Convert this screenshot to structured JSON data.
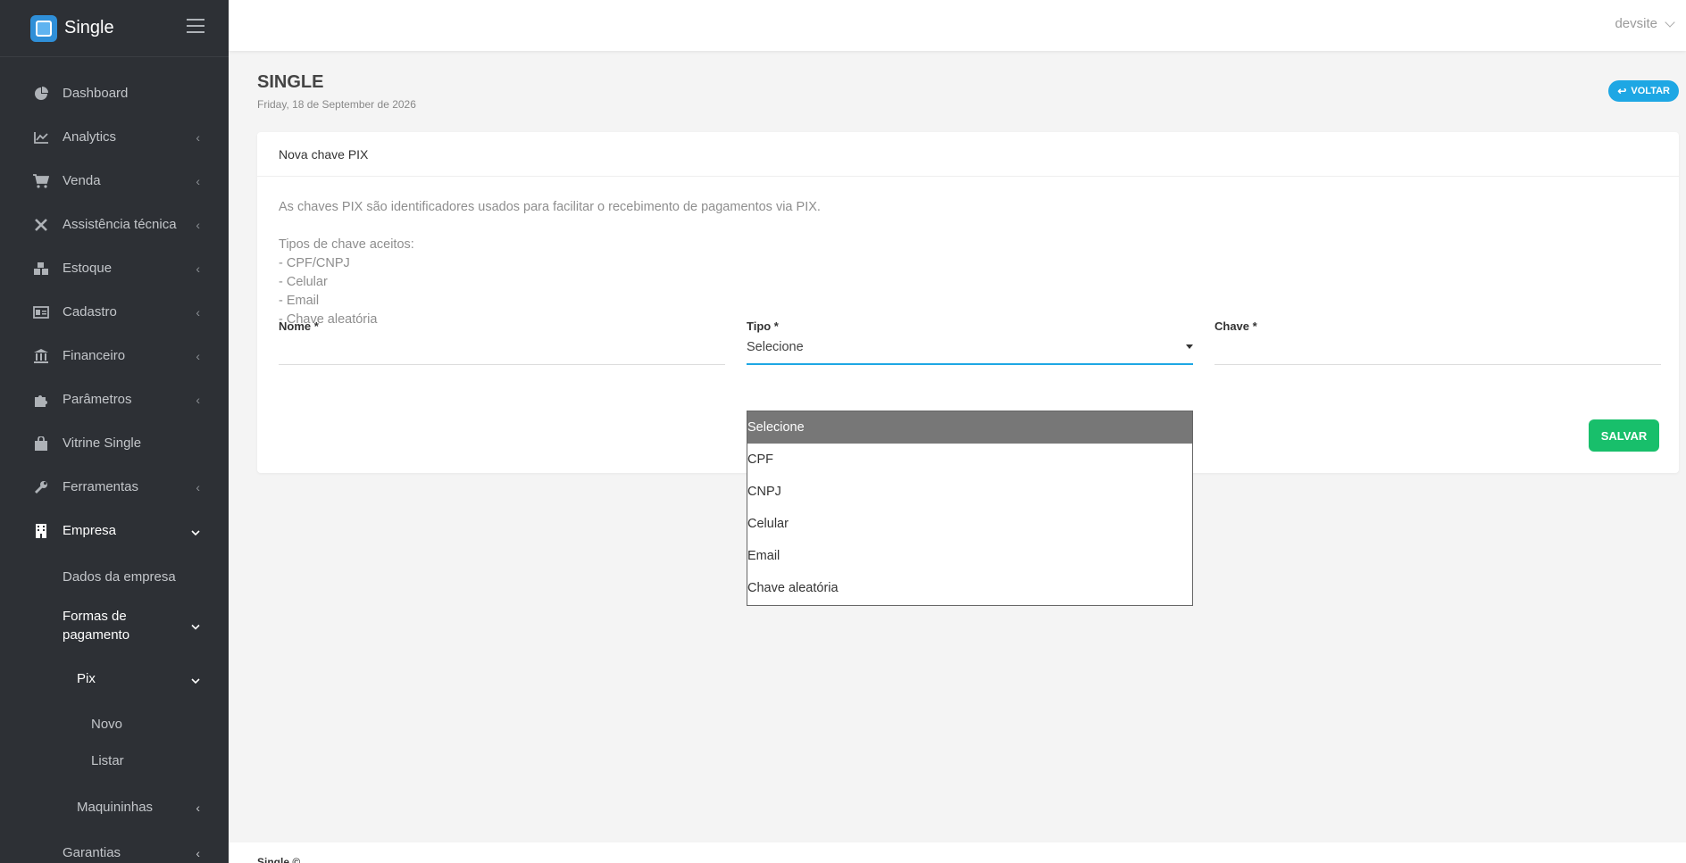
{
  "app": {
    "brand": "Single",
    "user": "devsite"
  },
  "sidebar": {
    "items": [
      {
        "label": "Dashboard",
        "icon": "pie-chart-icon",
        "chevron": ""
      },
      {
        "label": "Analytics",
        "icon": "line-chart-icon",
        "chevron": "‹"
      },
      {
        "label": "Venda",
        "icon": "cart-icon",
        "chevron": "‹"
      },
      {
        "label": "Assistência técnica",
        "icon": "tools-icon",
        "chevron": "‹"
      },
      {
        "label": "Estoque",
        "icon": "boxes-icon",
        "chevron": "‹"
      },
      {
        "label": "Cadastro",
        "icon": "id-card-icon",
        "chevron": "‹"
      },
      {
        "label": "Financeiro",
        "icon": "bank-icon",
        "chevron": "‹"
      },
      {
        "label": "Parâmetros",
        "icon": "puzzle-icon",
        "chevron": "‹"
      },
      {
        "label": "Vitrine Single",
        "icon": "shopping-bag-icon",
        "chevron": ""
      },
      {
        "label": "Ferramentas",
        "icon": "wrench-icon",
        "chevron": "‹"
      },
      {
        "label": "Empresa",
        "icon": "building-icon",
        "chevron": "⌄"
      }
    ],
    "empresa_sub": {
      "dados": "Dados da empresa",
      "formas_line1": "Formas de",
      "formas_line2": "pagamento",
      "pix": "Pix",
      "novo": "Novo",
      "listar": "Listar",
      "maquininhas": "Maquininhas",
      "garantias": "Garantias"
    }
  },
  "header": {
    "title": "SINGLE",
    "date": "Friday, 18 de September de 2026",
    "back_button": "VOLTAR"
  },
  "card": {
    "title": "Nova chave PIX",
    "description": "As chaves PIX são identificadores usados para facilitar o recebimento de pagamentos via PIX.",
    "types_title": "Tipos de chave aceitos:",
    "types": [
      "- CPF/CNPJ",
      "- Celular",
      "- Email",
      "- Chave aleatória"
    ],
    "fields": {
      "nome_label": "Nome *",
      "tipo_label": "Tipo *",
      "tipo_value": "Selecione",
      "chave_label": "Chave *"
    },
    "save_button": "SALVAR"
  },
  "dropdown": {
    "options": [
      "Selecione",
      "CPF",
      "CNPJ",
      "Celular",
      "Email",
      "Chave aleatória"
    ],
    "selected": "Selecione"
  },
  "footer": {
    "text": "Single ©"
  },
  "colors": {
    "accent": "#1ea7e4",
    "success": "#18bf6b",
    "sidebar": "#2d3035"
  }
}
